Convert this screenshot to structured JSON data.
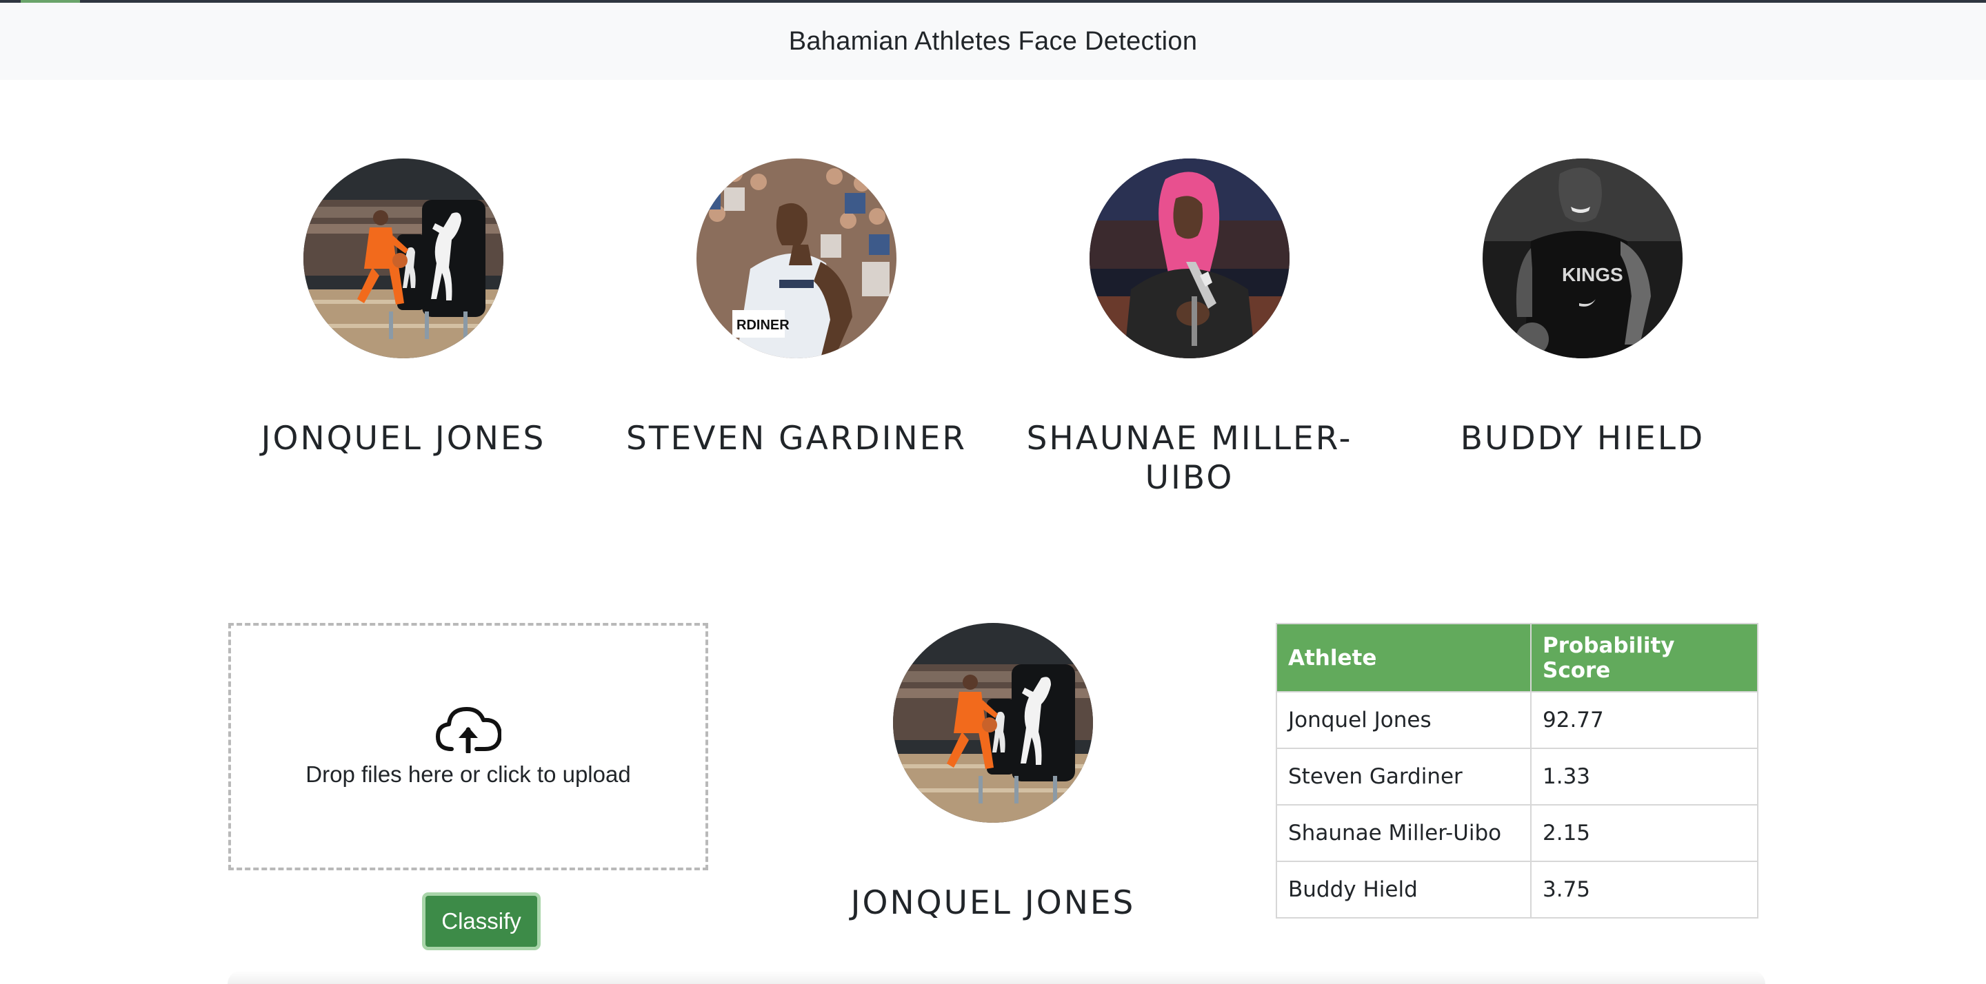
{
  "app": {
    "title": "Bahamian Athletes Face Detection"
  },
  "athletes": [
    {
      "name": "JONQUEL JONES",
      "photo_icon": "basketball-player-photo"
    },
    {
      "name": "STEVEN GARDINER",
      "photo_icon": "sprinter-photo"
    },
    {
      "name": "SHAUNAE MILLER-UIBO",
      "photo_icon": "athlete-with-trophy-photo"
    },
    {
      "name": "BUDDY HIELD",
      "photo_icon": "basketball-player-bw-photo"
    }
  ],
  "upload": {
    "text": "Drop files here or click to upload",
    "icon": "cloud-upload-icon"
  },
  "classify_button": {
    "label": "Classify"
  },
  "result": {
    "name": "JONQUEL JONES"
  },
  "table": {
    "headers": [
      "Athlete",
      "Probability Score"
    ],
    "rows": [
      [
        "Jonquel Jones",
        "92.77"
      ],
      [
        "Steven Gardiner",
        "1.33"
      ],
      [
        "Shaunae Miller-Uibo",
        "2.15"
      ],
      [
        "Buddy Hield",
        "3.75"
      ]
    ]
  },
  "colors": {
    "accent_green": "#62aa5c",
    "button_green": "#3d8b48",
    "navbar_bg": "#f8f9fa"
  }
}
